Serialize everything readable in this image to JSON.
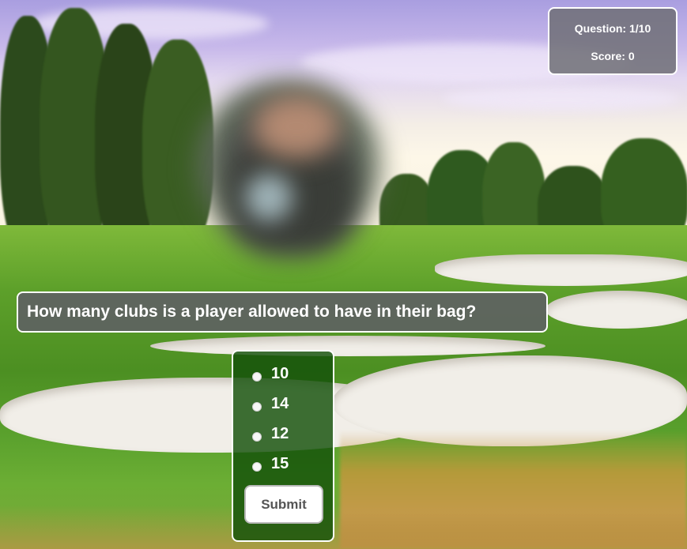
{
  "hud": {
    "question_counter": "Question: 1/10",
    "score": "Score: 0"
  },
  "quiz": {
    "question": "How many clubs is a player allowed to have in their bag?",
    "options": [
      "10",
      "14",
      "12",
      "15"
    ],
    "submit_label": "Submit"
  },
  "colors": {
    "panel_bg": "#5f5f64",
    "options_bg": "#14500a",
    "border": "#ffffff"
  }
}
